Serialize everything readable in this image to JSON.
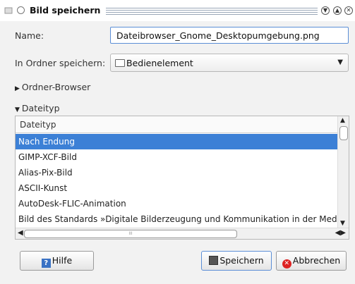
{
  "window": {
    "title": "Bild speichern"
  },
  "form": {
    "name_label": "Name:",
    "name_value": "Dateibrowser_Gnome_Desktopumgebung.png",
    "folder_label": "In Ordner speichern:",
    "folder_value": "Bedienelement"
  },
  "expanders": {
    "browser_label": "Ordner-Browser",
    "filetype_label": "Dateityp"
  },
  "filetype_list": {
    "header": "Dateityp",
    "items": [
      "Nach Endung",
      "GIMP-XCF-Bild",
      "Alias-Pix-Bild",
      "ASCII-Kunst",
      "AutoDesk-FLIC-Animation",
      "Bild des Standards »Digitale Bilderzeugung und Kommunikation in der Medi"
    ],
    "selected_index": 0
  },
  "buttons": {
    "help": "Hilfe",
    "save": "Speichern",
    "cancel": "Abbrechen"
  },
  "colors": {
    "selection": "#3c80d6",
    "focus_border": "#5b8ed6"
  },
  "icons": {
    "help": "help-icon",
    "save": "floppy-disk-icon",
    "cancel": "cancel-icon",
    "folder": "folder-icon"
  }
}
